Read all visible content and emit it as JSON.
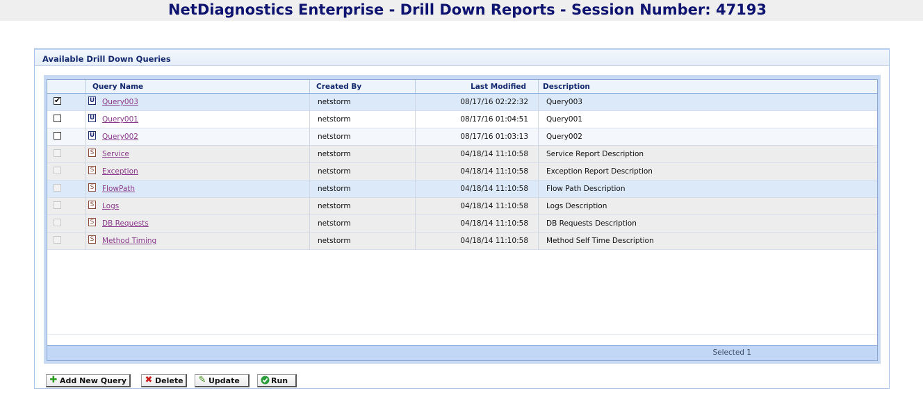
{
  "page": {
    "title": "NetDiagnostics Enterprise - Drill Down Reports - Session Number: 47193"
  },
  "panel": {
    "title": "Available Drill Down Queries"
  },
  "table": {
    "columns": [
      "Query  Name",
      "Created By",
      "Last Modified",
      "Description"
    ],
    "rows": [
      {
        "checked": true,
        "enabled": true,
        "type": "U",
        "name": "Query003",
        "created_by": "netstorm",
        "modified": "08/17/16 02:22:32",
        "description": "Query003"
      },
      {
        "checked": false,
        "enabled": true,
        "type": "U",
        "name": "Query001",
        "created_by": "netstorm",
        "modified": "08/17/16 01:04:51",
        "description": "Query001"
      },
      {
        "checked": false,
        "enabled": true,
        "type": "U",
        "name": "Query002",
        "created_by": "netstorm",
        "modified": "08/17/16 01:03:13",
        "description": "Query002"
      },
      {
        "checked": false,
        "enabled": false,
        "type": "S",
        "name": "Service",
        "created_by": "netstorm",
        "modified": "04/18/14 11:10:58",
        "description": "Service Report Description"
      },
      {
        "checked": false,
        "enabled": false,
        "type": "S",
        "name": "Exception",
        "created_by": "netstorm",
        "modified": "04/18/14 11:10:58",
        "description": "Exception Report Description"
      },
      {
        "checked": false,
        "enabled": false,
        "type": "S",
        "name": "FlowPath",
        "created_by": "netstorm",
        "modified": "04/18/14 11:10:58",
        "description": "Flow Path Description"
      },
      {
        "checked": false,
        "enabled": false,
        "type": "S",
        "name": "Logs",
        "created_by": "netstorm",
        "modified": "04/18/14 11:10:58",
        "description": "Logs Description"
      },
      {
        "checked": false,
        "enabled": false,
        "type": "S",
        "name": "DB Requests",
        "created_by": "netstorm",
        "modified": "04/18/14 11:10:58",
        "description": "DB Requests Description"
      },
      {
        "checked": false,
        "enabled": false,
        "type": "S",
        "name": "Method Timing",
        "created_by": "netstorm",
        "modified": "04/18/14 11:10:58",
        "description": "Method Self Time Description"
      }
    ],
    "footer": "Selected 1"
  },
  "buttons": {
    "add_label": "Add New Query",
    "delete_label": "Delete",
    "update_label": "Update",
    "run_label": "Run"
  },
  "icons": {
    "user_query": "user-query-icon",
    "system_query": "system-query-icon",
    "add": "plus-icon",
    "delete": "x-icon",
    "update": "pencil-icon",
    "run": "check-circle-icon"
  },
  "colors": {
    "title": "#0e1370",
    "link": "#8a3a8a",
    "selected_row": "#dce9f9",
    "system_row": "#ededed",
    "footer": "#c2d7f6"
  }
}
